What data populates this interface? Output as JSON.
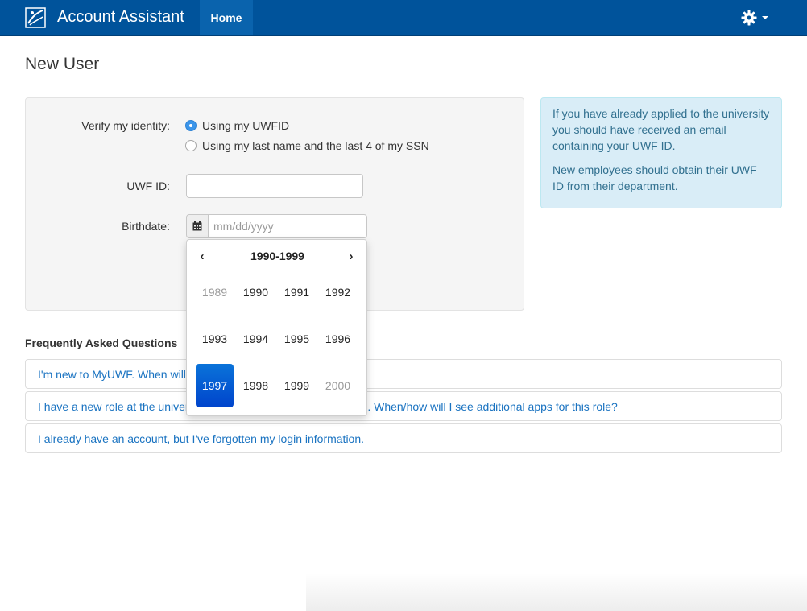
{
  "navbar": {
    "brand_title": "Account Assistant",
    "home_label": "Home",
    "logo_icon": "uwf-logo-icon",
    "settings_icon": "gear-icon",
    "colors": {
      "bar": "#00539b",
      "active_tab": "#0a63ad"
    }
  },
  "page": {
    "title": "New User"
  },
  "form": {
    "verify_label": "Verify my identity:",
    "options": [
      {
        "label": "Using my UWFID",
        "checked": true
      },
      {
        "label": "Using my last name and the last 4 of my SSN",
        "checked": false
      }
    ],
    "uwf_id_label": "UWF ID:",
    "uwf_id_value": "",
    "birthdate_label": "Birthdate:",
    "birthdate_placeholder": "mm/dd/yyyy",
    "calendar_icon": "calendar-icon"
  },
  "datepicker": {
    "prev": "‹",
    "next": "›",
    "title": "1990-1999",
    "years": [
      {
        "label": "1989",
        "state": "old"
      },
      {
        "label": "1990",
        "state": ""
      },
      {
        "label": "1991",
        "state": ""
      },
      {
        "label": "1992",
        "state": ""
      },
      {
        "label": "1993",
        "state": ""
      },
      {
        "label": "1994",
        "state": ""
      },
      {
        "label": "1995",
        "state": ""
      },
      {
        "label": "1996",
        "state": ""
      },
      {
        "label": "1997",
        "state": "active"
      },
      {
        "label": "1998",
        "state": ""
      },
      {
        "label": "1999",
        "state": ""
      },
      {
        "label": "2000",
        "state": "old"
      }
    ],
    "active_color": "#0055cc"
  },
  "info": {
    "para1": "If you have already applied to the university you should have received an email containing your UWF ID.",
    "para2": "New employees should obtain their UWF ID from their department."
  },
  "faq": {
    "title": "Frequently Asked Questions",
    "items": [
      "I'm new to MyUWF. When will I see my apps?",
      "I have a new role at the university (e.g., new employee or student). When/how will I see additional apps for this role?",
      "I already have an account, but I've forgotten my login information."
    ]
  }
}
